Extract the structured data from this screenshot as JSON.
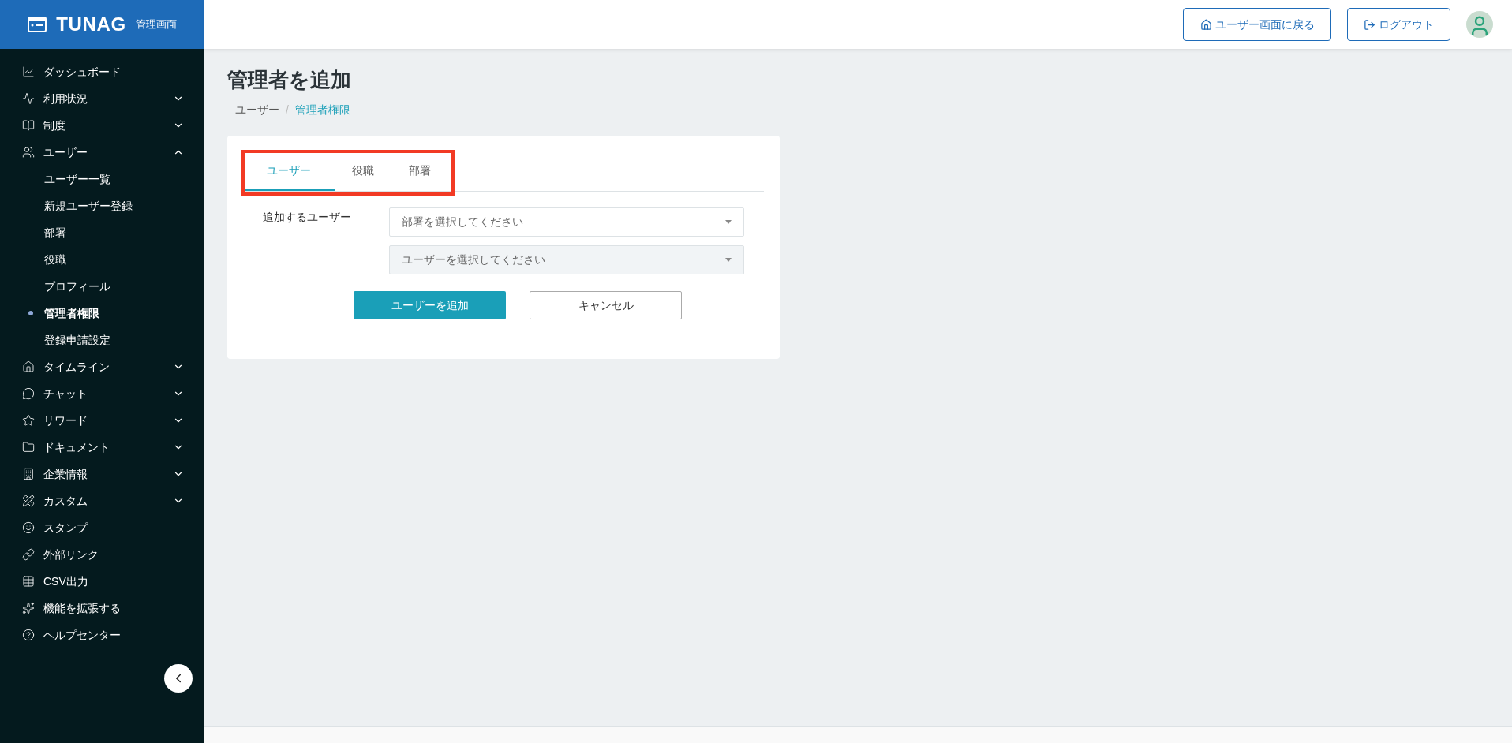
{
  "logo": {
    "wordmark": "TUNAG",
    "subtitle": "管理画面"
  },
  "header": {
    "buttons": [
      {
        "kind": "home",
        "label": "ユーザー画面に戻る"
      },
      {
        "kind": "logout",
        "label": "ログアウト"
      }
    ]
  },
  "sidebar": {
    "items": [
      {
        "label": "ダッシュボード",
        "kind": "plain"
      },
      {
        "label": "利用状況",
        "kind": "group",
        "expanded": false
      },
      {
        "label": "制度",
        "kind": "group",
        "expanded": false
      },
      {
        "label": "ユーザー",
        "kind": "group",
        "expanded": true,
        "children": [
          {
            "label": "ユーザー一覧",
            "selected": false
          },
          {
            "label": "新規ユーザー登録",
            "selected": false
          },
          {
            "label": "部署",
            "selected": false
          },
          {
            "label": "役職",
            "selected": false
          },
          {
            "label": "プロフィール",
            "selected": false
          },
          {
            "label": "管理者権限",
            "selected": true
          },
          {
            "label": "登録申請設定",
            "selected": false
          }
        ]
      },
      {
        "label": "タイムライン",
        "kind": "group",
        "expanded": false
      },
      {
        "label": "チャット",
        "kind": "group",
        "expanded": false
      },
      {
        "label": "リワード",
        "kind": "group",
        "expanded": false
      },
      {
        "label": "ドキュメント",
        "kind": "group",
        "expanded": false
      },
      {
        "label": "企業情報",
        "kind": "group",
        "expanded": false
      },
      {
        "label": "カスタム",
        "kind": "group",
        "expanded": false
      },
      {
        "label": "スタンプ",
        "kind": "plain"
      },
      {
        "label": "外部リンク",
        "kind": "plain"
      },
      {
        "label": "CSV出力",
        "kind": "plain"
      },
      {
        "label": "機能を拡張する",
        "kind": "plain"
      },
      {
        "label": "ヘルプセンター",
        "kind": "plain"
      }
    ]
  },
  "page": {
    "title": "管理者を追加",
    "breadcrumb": [
      {
        "label": "ユーザー",
        "current": false
      },
      {
        "label": "管理者権限",
        "current": true
      }
    ],
    "breadcrumb_separator": "/"
  },
  "tabs": [
    {
      "label": "ユーザー",
      "selected": true
    },
    {
      "label": "役職",
      "selected": false
    },
    {
      "label": "部署",
      "selected": false
    }
  ],
  "form": {
    "label": "追加するユーザー",
    "selects": [
      {
        "placeholder": "部署を選択してください",
        "disabled": false
      },
      {
        "placeholder": "ユーザーを選択してください",
        "disabled": true
      }
    ]
  },
  "actions": {
    "primary": "ユーザーを追加",
    "secondary": "キャンセル"
  }
}
